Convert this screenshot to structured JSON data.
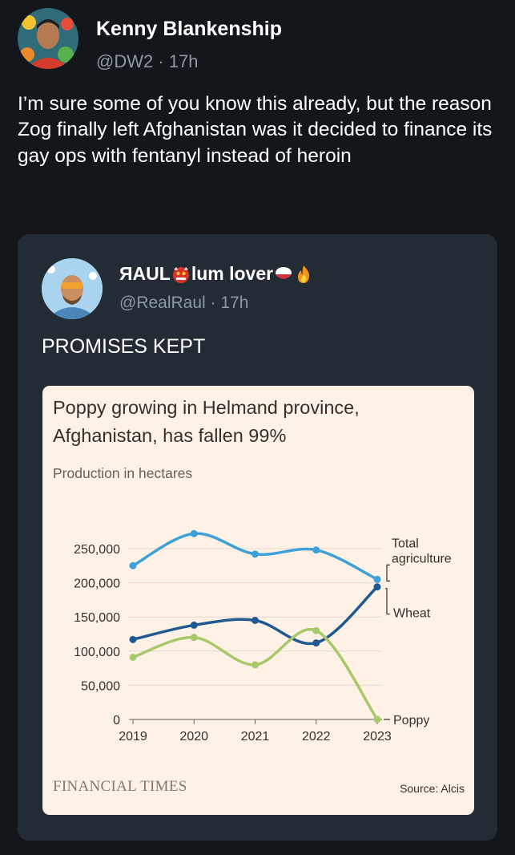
{
  "tweet": {
    "author_name": "Kenny Blankenship",
    "handle": "@DW2",
    "time": "17h",
    "text": "I’m sure some of you know this already, but the reason Zog finally left Afghanistan was it decided to finance its gay ops with fentanyl instead of heroin"
  },
  "quote": {
    "name_part1": "ЯAUL",
    "name_part2": "lum lover",
    "handle": "@RealRaul",
    "time": "17h",
    "text": "PROMISES KEPT",
    "name_emojis": [
      "ogre-emoji",
      "rice-bowl-emoji",
      "fire-emoji"
    ]
  },
  "chart": {
    "title": "Poppy growing in Helmand province, Afghanistan, has fallen 99%",
    "subtitle": "Production in hectares",
    "logo": "FINANCIAL TIMES",
    "source": "Source: Alcis"
  },
  "chart_data": {
    "type": "line",
    "title": "Poppy growing in Helmand province, Afghanistan, has fallen 99%",
    "subtitle": "Production in hectares",
    "x": [
      2019,
      2020,
      2021,
      2022,
      2023
    ],
    "ylim": [
      0,
      250000
    ],
    "yticks": [
      0,
      50000,
      100000,
      150000,
      200000,
      250000
    ],
    "ytick_labels": [
      "0",
      "50,000",
      "100,000",
      "150,000",
      "200,000",
      "250,000"
    ],
    "grid": true,
    "series": [
      {
        "name": "Total agriculture",
        "values": [
          225000,
          272000,
          242000,
          248000,
          205000
        ],
        "color": "#3ea0d8",
        "label_lines": [
          "Total",
          "agriculture"
        ]
      },
      {
        "name": "Wheat",
        "values": [
          117000,
          138000,
          145000,
          112000,
          194000
        ],
        "color": "#1f5a92",
        "label_lines": [
          "Wheat"
        ]
      },
      {
        "name": "Poppy",
        "values": [
          91000,
          120000,
          80000,
          130000,
          0
        ],
        "color": "#a7c96b",
        "label_lines": [
          "Poppy"
        ]
      }
    ],
    "source": "Source: Alcis"
  }
}
